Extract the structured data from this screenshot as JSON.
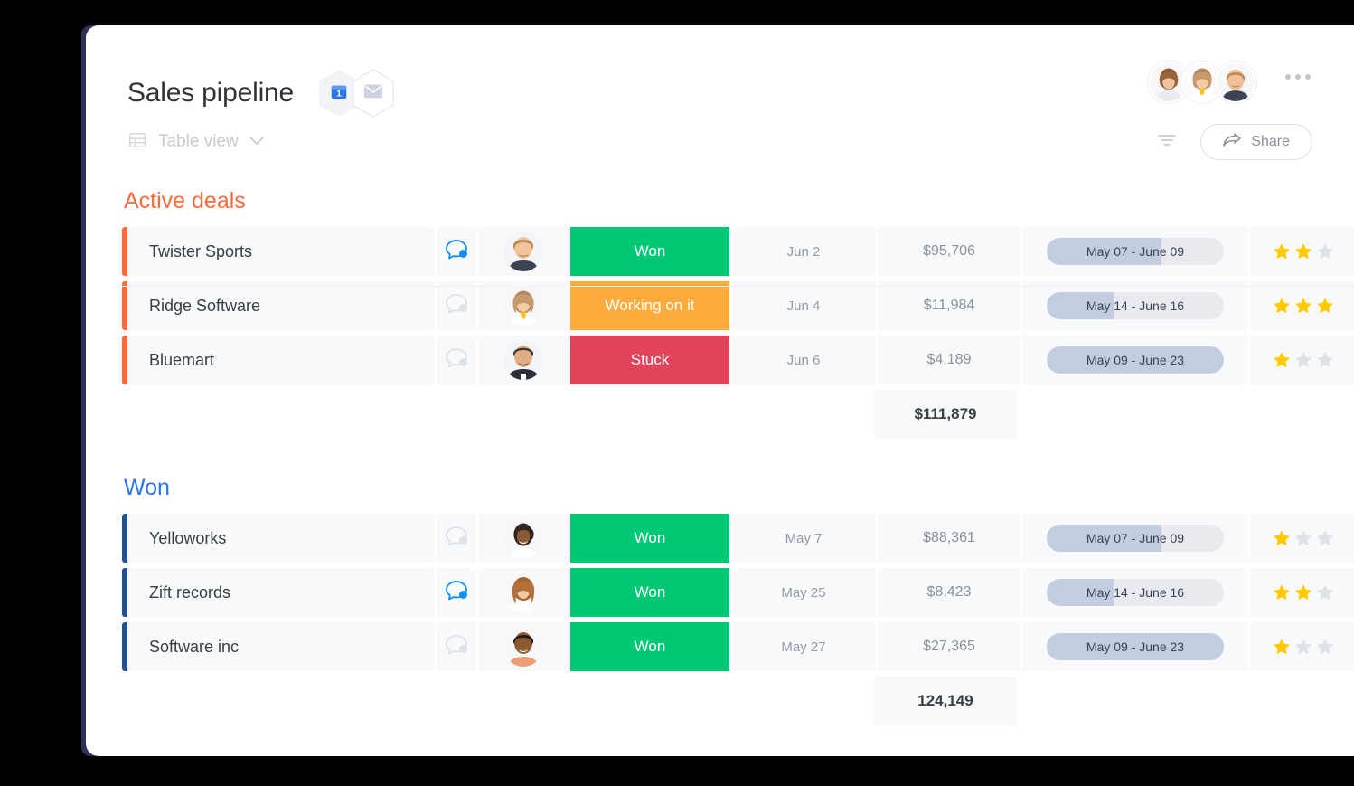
{
  "app": {
    "logo_name": "monday-logo",
    "sidebar_icons": [
      "notifications-bell-icon",
      "search-icon",
      "invite-member-icon"
    ]
  },
  "header": {
    "title": "Sales pipeline",
    "hex_icons": [
      {
        "name": "activity-badge-icon",
        "badge": "1"
      },
      {
        "name": "inbox-mail-icon"
      }
    ],
    "avatars": [
      "avatar-1",
      "avatar-2",
      "avatar-3"
    ],
    "more_menu_label": "…"
  },
  "toolbar": {
    "view_icon": "table-view-icon",
    "view_label": "Table view",
    "chevron": "chevron-down-icon",
    "filter_icon": "filter-icon",
    "share_icon": "share-arrow-icon",
    "share_label": "Share"
  },
  "colors": {
    "accent_orange": "#fb6b3c",
    "accent_blue": "#2b76e5",
    "row_accent_blue": "#225091",
    "status_won": "#00c875",
    "status_working": "#fdab3d",
    "status_stuck": "#e2445c",
    "star_filled": "#ffcb00",
    "star_empty": "#dfe1e8",
    "sidebar_bg": "#2d3159",
    "timeline_fill": "#c3cde0",
    "timeline_track": "#e8eaf0"
  },
  "groups": [
    {
      "title": "Active deals",
      "color_class": "orange",
      "accent": "accent-orange",
      "rows": [
        {
          "name": "Twister Sports",
          "chat_active": true,
          "person": "person-male-1",
          "status": "Won",
          "status_class": "st-won",
          "date": "Jun 2",
          "amount": "$95,706",
          "timeline": "May 07 - June 09",
          "timeline_pct": 65,
          "rating": 2,
          "rating_max": 3
        },
        {
          "name": "Ridge Software",
          "chat_active": false,
          "person": "person-female-1",
          "status": "Working on it",
          "status_class": "st-working",
          "date": "Jun 4",
          "amount": "$11,984",
          "timeline": "May 14 - June 16",
          "timeline_pct": 38,
          "rating": 3,
          "rating_max": 3
        },
        {
          "name": "Bluemart",
          "chat_active": false,
          "person": "person-male-2",
          "status": "Stuck",
          "status_class": "st-stuck",
          "date": "Jun 6",
          "amount": "$4,189",
          "timeline": "May 09 - June 23",
          "timeline_pct": 100,
          "rating": 1,
          "rating_max": 3
        }
      ],
      "sum": "$111,879"
    },
    {
      "title": "Won",
      "color_class": "blue",
      "accent": "accent-blue",
      "rows": [
        {
          "name": "Yelloworks",
          "chat_active": false,
          "person": "person-female-2",
          "status": "Won",
          "status_class": "st-won",
          "date": "May 7",
          "amount": "$88,361",
          "timeline": "May 07 - June 09",
          "timeline_pct": 65,
          "rating": 1,
          "rating_max": 3
        },
        {
          "name": "Zift records",
          "chat_active": true,
          "person": "person-female-3",
          "status": "Won",
          "status_class": "st-won",
          "date": "May 25",
          "amount": "$8,423",
          "timeline": "May 14 - June 16",
          "timeline_pct": 38,
          "rating": 2,
          "rating_max": 3
        },
        {
          "name": "Software inc",
          "chat_active": false,
          "person": "person-male-3",
          "status": "Won",
          "status_class": "st-won",
          "date": "May 27",
          "amount": "$27,365",
          "timeline": "May 09 - June 23",
          "timeline_pct": 100,
          "rating": 1,
          "rating_max": 3
        }
      ],
      "sum": "124,149"
    }
  ]
}
